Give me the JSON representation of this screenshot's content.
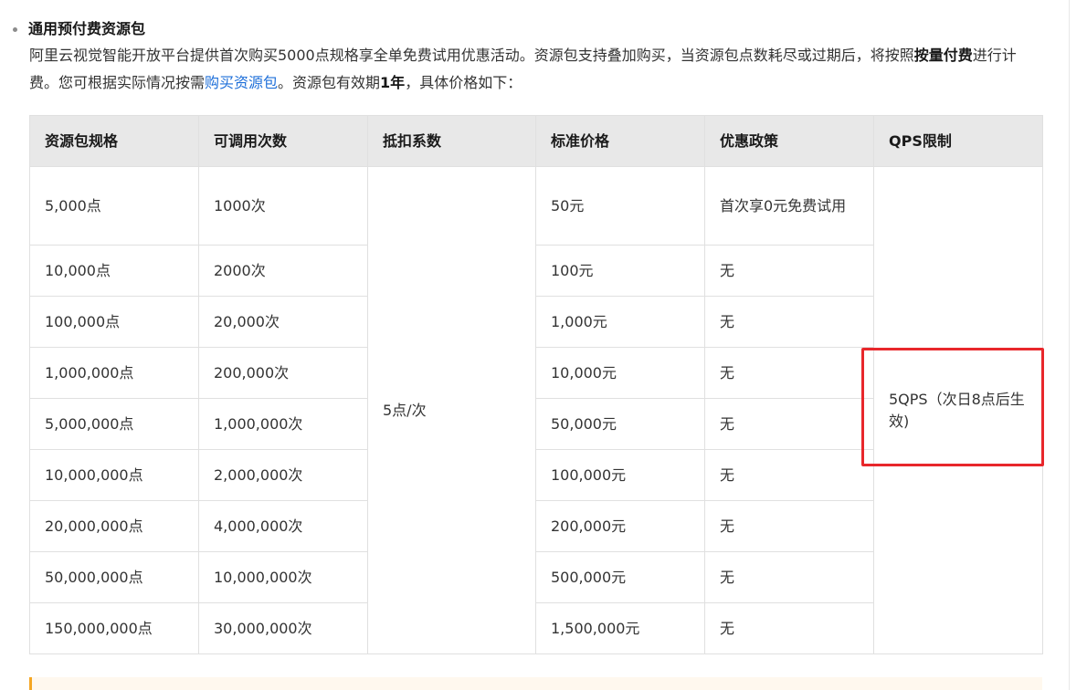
{
  "section": {
    "heading": "通用预付费资源包",
    "para": {
      "text1": "阿里云视觉智能开放平台提供首次购买5000点规格享全单免费试用优惠活动。资源包支持叠加购买，当资源包点数耗尽或过期后，将按照",
      "bold1": "按量付费",
      "text2": "进行计费。您可根据实际情况按需",
      "link": "购买资源包",
      "text3": "。资源包有效期",
      "bold2": "1年",
      "text4": "，具体价格如下："
    }
  },
  "table": {
    "headers": [
      "资源包规格",
      "可调用次数",
      "抵扣系数",
      "标准价格",
      "优惠政策",
      "QPS限制"
    ],
    "deduction": "5点/次",
    "qps": "5QPS（次日8点后生效)",
    "rows": [
      {
        "spec": "5,000点",
        "calls": "1000次",
        "price": "50元",
        "promo": "首次享0元免费试用"
      },
      {
        "spec": "10,000点",
        "calls": "2000次",
        "price": "100元",
        "promo": "无"
      },
      {
        "spec": "100,000点",
        "calls": "20,000次",
        "price": "1,000元",
        "promo": "无"
      },
      {
        "spec": "1,000,000点",
        "calls": "200,000次",
        "price": "10,000元",
        "promo": "无"
      },
      {
        "spec": "5,000,000点",
        "calls": "1,000,000次",
        "price": "50,000元",
        "promo": "无"
      },
      {
        "spec": "10,000,000点",
        "calls": "2,000,000次",
        "price": "100,000元",
        "promo": "无"
      },
      {
        "spec": "20,000,000点",
        "calls": "4,000,000次",
        "price": "200,000元",
        "promo": "无"
      },
      {
        "spec": "50,000,000点",
        "calls": "10,000,000次",
        "price": "500,000元",
        "promo": "无"
      },
      {
        "spec": "150,000,000点",
        "calls": "30,000,000次",
        "price": "1,500,000元",
        "promo": "无"
      }
    ]
  },
  "colors": {
    "link": "#1e6fd9",
    "highlight_border": "#e8272b",
    "header_bg": "#e8e8e8"
  }
}
